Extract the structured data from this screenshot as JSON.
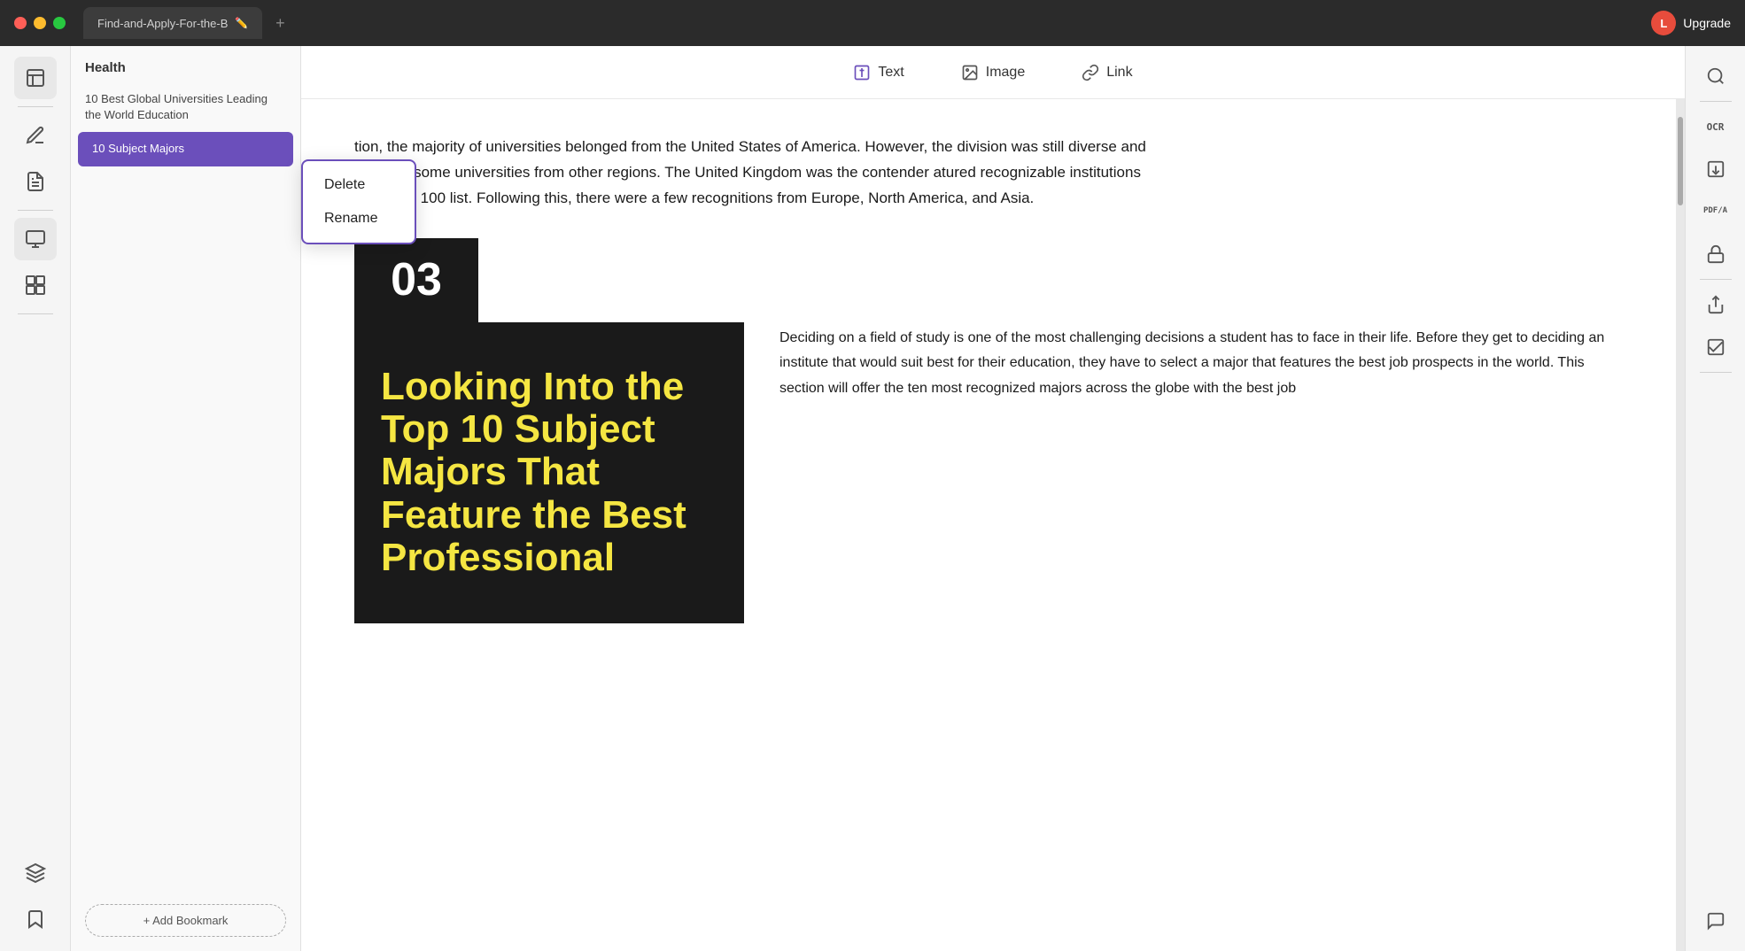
{
  "window": {
    "title": "Find-and-Apply-For-the-B"
  },
  "titlebar": {
    "tab_title": "Find-and-Apply-For-the-B",
    "new_tab_label": "+",
    "upgrade_label": "Upgrade",
    "avatar_letter": "L"
  },
  "left_sidebar": {
    "icons": [
      {
        "name": "bookmarks-icon",
        "symbol": "📄"
      },
      {
        "name": "highlight-icon",
        "symbol": "✏️"
      },
      {
        "name": "notes-icon",
        "symbol": "📝"
      },
      {
        "name": "pages-icon",
        "symbol": "▦"
      },
      {
        "name": "copy-icon",
        "symbol": "⧉"
      },
      {
        "name": "layers-icon",
        "symbol": "◫"
      },
      {
        "name": "bookmark-add-icon",
        "symbol": "🔖"
      }
    ]
  },
  "bookmarks_panel": {
    "header": "Health",
    "items": [
      {
        "label": "10 Best Global Universities Leading the World Education",
        "active": false
      },
      {
        "label": "10 Subject Majors",
        "active": true
      }
    ],
    "add_bookmark_label": "+ Add Bookmark"
  },
  "toolbar": {
    "items": [
      {
        "label": "Text",
        "icon": "text-icon",
        "active": true
      },
      {
        "label": "Image",
        "icon": "image-icon",
        "active": false
      },
      {
        "label": "Link",
        "icon": "link-icon",
        "active": false
      }
    ]
  },
  "document": {
    "paragraph1": "tion, the majority of universities belonged from the United States of America. However, the division was still diverse and featured some universities from other regions. The United Kingdom was the contender atured recognizable institutions in the top 100 list. Following this, there were a few recognitions from Europe, North America, and Asia.",
    "section_number": "03",
    "section_image_text": "Looking Into the Top 10 Subject Majors That Feature the Best Professional",
    "section_description": "Deciding on a field of study is one of the most challenging decisions a student has to face in their life. Before they get to deciding an institute that would suit best for their education, they have to select a major that features the best job prospects in the world. This section will offer the ten most recognized majors across the globe with the best job"
  },
  "context_menu": {
    "items": [
      "Delete",
      "Rename"
    ]
  },
  "right_sidebar": {
    "icons": [
      {
        "name": "search-icon",
        "symbol": "🔍"
      },
      {
        "name": "ocr-icon",
        "label": "OCR"
      },
      {
        "name": "extract-icon",
        "symbol": "⬇"
      },
      {
        "name": "pdfa-icon",
        "label": "PDF/A"
      },
      {
        "name": "lock-icon",
        "symbol": "🔒"
      },
      {
        "name": "share-icon",
        "symbol": "⬆"
      },
      {
        "name": "check-icon",
        "symbol": "✓"
      },
      {
        "name": "chat-icon",
        "symbol": "💬"
      }
    ]
  }
}
